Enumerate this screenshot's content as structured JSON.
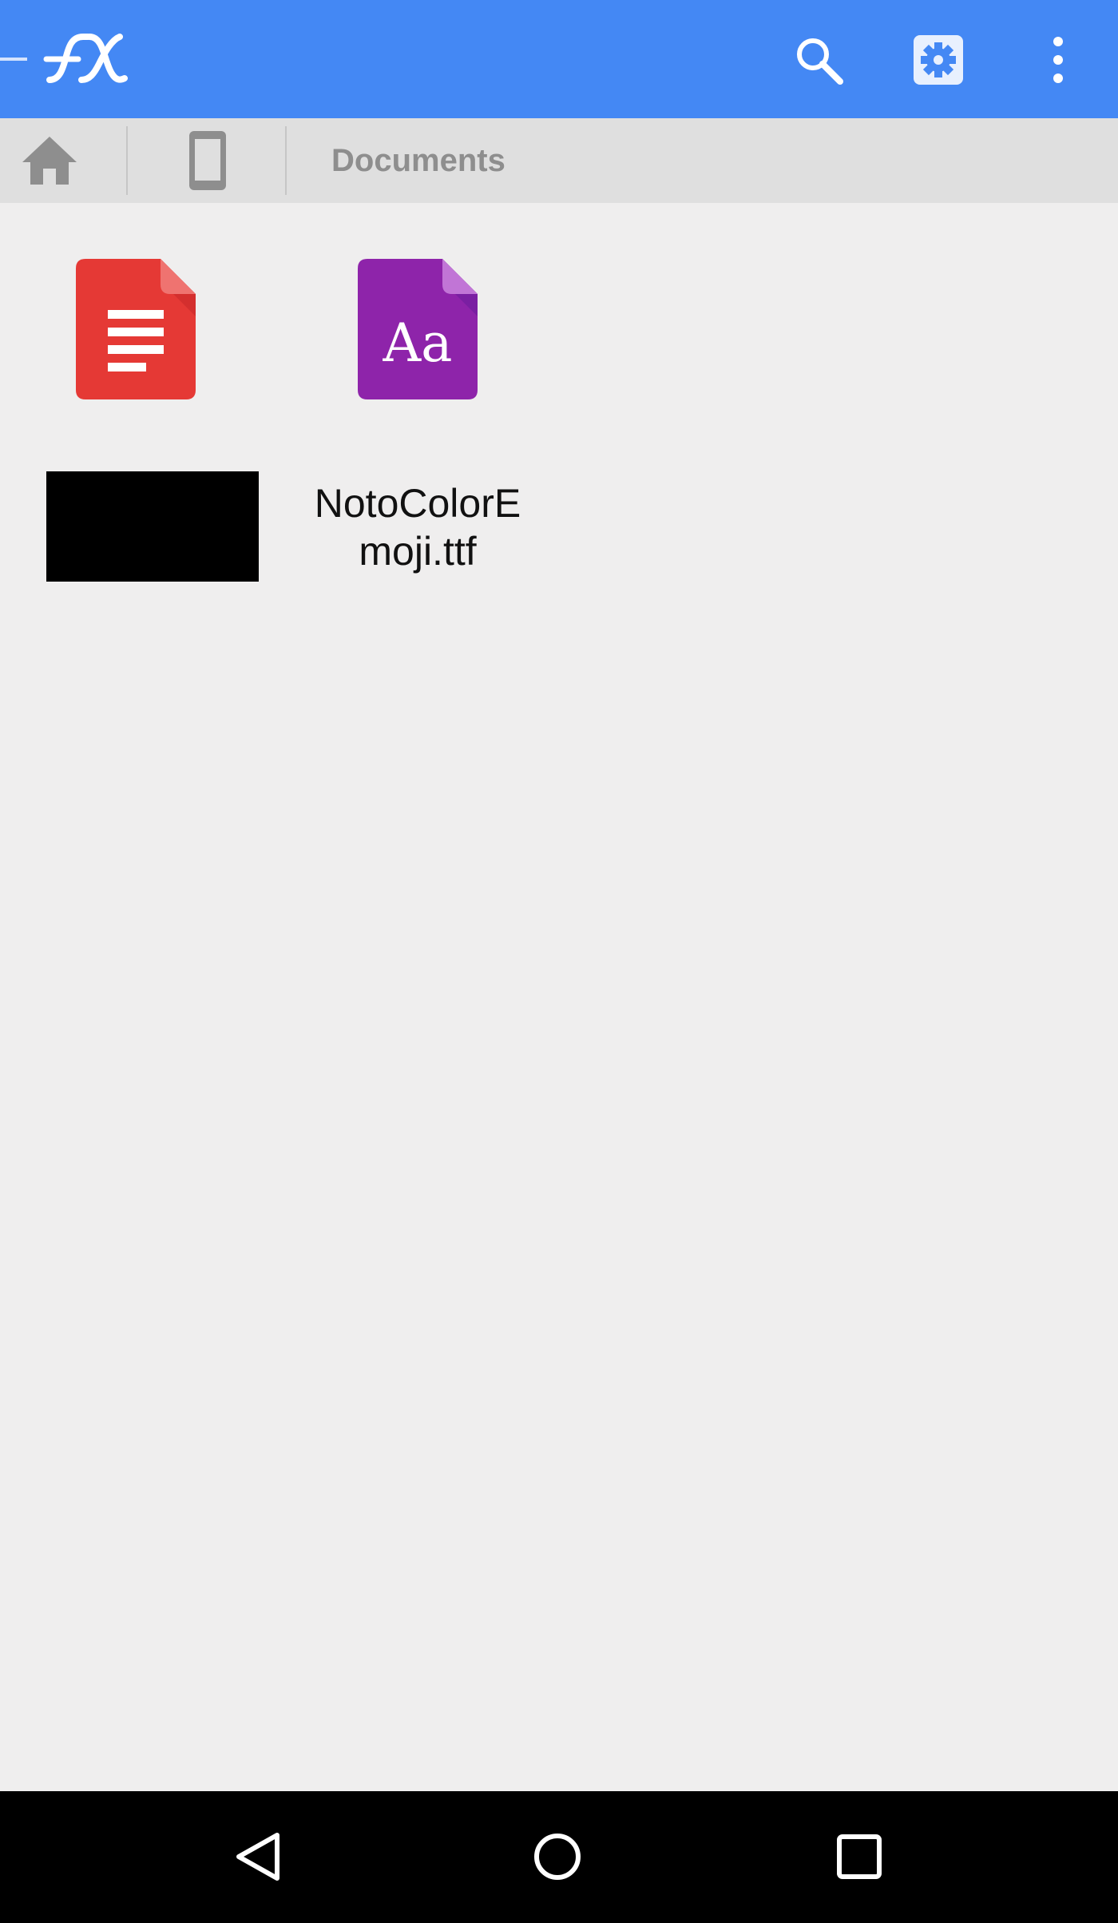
{
  "app": {
    "name": "FX File Explorer",
    "accent": "#4488f4"
  },
  "toolbar": {
    "actions": [
      {
        "icon": "search-icon",
        "label": "Search"
      },
      {
        "icon": "settings-icon",
        "label": "Settings"
      },
      {
        "icon": "more-vert-icon",
        "label": "More options"
      }
    ]
  },
  "breadcrumb": {
    "items": [
      {
        "icon": "home-icon"
      },
      {
        "icon": "phone-icon"
      },
      {
        "label": "Documents"
      }
    ]
  },
  "files": [
    {
      "icon": "document-icon",
      "color": "#e53935",
      "name_redacted": true
    },
    {
      "icon": "font-file-icon",
      "color": "#8e24aa",
      "glyph": "Aa",
      "name": "NotoColorEmoji.ttf"
    }
  ],
  "navbar": {
    "buttons": [
      {
        "icon": "back-icon"
      },
      {
        "icon": "home-circle-icon"
      },
      {
        "icon": "recents-icon"
      }
    ]
  }
}
